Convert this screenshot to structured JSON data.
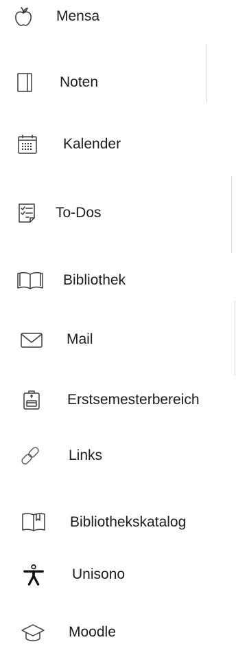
{
  "menu": {
    "items": [
      {
        "label": "Mensa",
        "icon": "apple-icon"
      },
      {
        "label": "Noten",
        "icon": "notebook-icon"
      },
      {
        "label": "Kalender",
        "icon": "calendar-icon"
      },
      {
        "label": "To-Dos",
        "icon": "checklist-icon"
      },
      {
        "label": "Bibliothek",
        "icon": "open-book-icon"
      },
      {
        "label": "Mail",
        "icon": "envelope-icon"
      },
      {
        "label": "Erstsemesterbereich",
        "icon": "backpack-icon"
      },
      {
        "label": "Links",
        "icon": "link-icon"
      },
      {
        "label": "Bibliothekskatalog",
        "icon": "bookmark-book-icon"
      },
      {
        "label": "Unisono",
        "icon": "accessibility-icon"
      },
      {
        "label": "Moodle",
        "icon": "graduation-cap-icon"
      }
    ]
  },
  "colors": {
    "text": "#1c1c1e",
    "icon": "#3a3a3c",
    "divider": "#d8d8dc",
    "background": "#ffffff"
  }
}
